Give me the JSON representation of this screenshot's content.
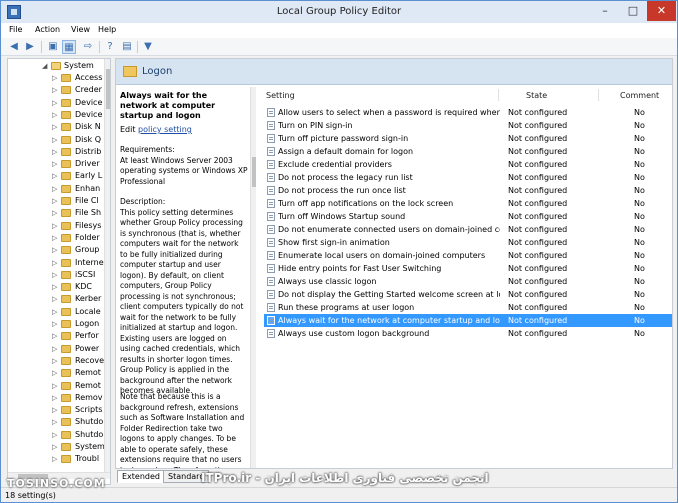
{
  "window": {
    "title": "Local Group Policy Editor"
  },
  "menu": [
    "File",
    "Action",
    "View",
    "Help"
  ],
  "toolbar_icons": [
    "back-icon",
    "forward-icon",
    "up-icon",
    "show-tree-icon",
    "export-icon",
    "help-icon",
    "properties-icon",
    "filter-icon"
  ],
  "tree": {
    "root": "System",
    "items": [
      "Access",
      "Creder",
      "Device",
      "Device",
      "Disk N",
      "Disk Q",
      "Distrib",
      "Driver",
      "Early L",
      "Enhan",
      "File Cl",
      "File Sh",
      "Filesys",
      "Folder",
      "Group",
      "Interne",
      "iSCSI",
      "KDC",
      "Kerber",
      "Locale",
      "Logon",
      "Perfor",
      "Power",
      "Recove",
      "Remot",
      "Remot",
      "Remov",
      "Scripts",
      "Shutdo",
      "Shutdo",
      "System",
      "Troubl"
    ]
  },
  "header": {
    "title": "Logon"
  },
  "description": {
    "title": "Always wait for the network at computer startup and logon",
    "edit_prefix": "Edit",
    "edit_link": "policy setting",
    "requirements": "Requirements:\nAt least Windows Server 2003 operating systems or Windows XP Professional",
    "body1": "Description:\nThis policy setting determines whether Group Policy processing is synchronous (that is, whether computers wait for the network to be fully initialized during computer startup and user logon). By default, on client computers, Group Policy processing is not synchronous; client computers typically do not wait for the network to be fully initialized at startup and logon. Existing users are logged on using cached credentials, which results in shorter logon times. Group Policy is applied in the background after the network becomes available.",
    "body2": "Note that because this is a background refresh, extensions such as Software Installation and Folder Redirection take two logons to apply changes. To be able to operate safely, these extensions require that no users be logged on. Therefore, they must"
  },
  "list": {
    "columns": {
      "setting": "Setting",
      "state": "State",
      "comment": "Comment"
    },
    "rows": [
      {
        "setting": "Allow users to select when a password is required when resu...",
        "state": "Not configured",
        "comment": "No"
      },
      {
        "setting": "Turn on PIN sign-in",
        "state": "Not configured",
        "comment": "No"
      },
      {
        "setting": "Turn off picture password sign-in",
        "state": "Not configured",
        "comment": "No"
      },
      {
        "setting": "Assign a default domain for logon",
        "state": "Not configured",
        "comment": "No"
      },
      {
        "setting": "Exclude credential providers",
        "state": "Not configured",
        "comment": "No"
      },
      {
        "setting": "Do not process the legacy run list",
        "state": "Not configured",
        "comment": "No"
      },
      {
        "setting": "Do not process the run once list",
        "state": "Not configured",
        "comment": "No"
      },
      {
        "setting": "Turn off app notifications on the lock screen",
        "state": "Not configured",
        "comment": "No"
      },
      {
        "setting": "Turn off Windows Startup sound",
        "state": "Not configured",
        "comment": "No"
      },
      {
        "setting": "Do not enumerate connected users on domain-joined com...",
        "state": "Not configured",
        "comment": "No"
      },
      {
        "setting": "Show first sign-in animation",
        "state": "Not configured",
        "comment": "No"
      },
      {
        "setting": "Enumerate local users on domain-joined computers",
        "state": "Not configured",
        "comment": "No"
      },
      {
        "setting": "Hide entry points for Fast User Switching",
        "state": "Not configured",
        "comment": "No"
      },
      {
        "setting": "Always use classic logon",
        "state": "Not configured",
        "comment": "No"
      },
      {
        "setting": "Do not display the Getting Started welcome screen at logon",
        "state": "Not configured",
        "comment": "No"
      },
      {
        "setting": "Run these programs at user logon",
        "state": "Not configured",
        "comment": "No"
      },
      {
        "setting": "Always wait for the network at computer startup and logon",
        "state": "Not configured",
        "comment": "No"
      },
      {
        "setting": "Always use custom logon background",
        "state": "Not configured",
        "comment": "No"
      }
    ],
    "selected_index": 16
  },
  "tabs": [
    "Extended",
    "Standard"
  ],
  "status": "18 setting(s)",
  "watermark": {
    "left": "TOSINSO.COM",
    "right": "ITPro.ir - انجمن تخصصی فناوری اطلاعات ایران"
  }
}
